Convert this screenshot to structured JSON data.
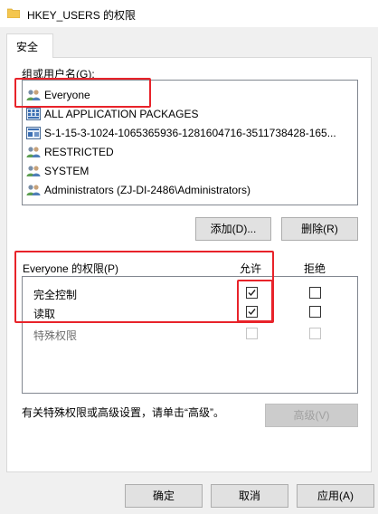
{
  "window": {
    "title": "HKEY_USERS 的权限",
    "icon": "folder-icon"
  },
  "tabs": [
    {
      "label": "安全",
      "active": true
    }
  ],
  "groups": {
    "label": "组或用户名(G):",
    "items": [
      {
        "name": "Everyone",
        "icon": "users-icon",
        "selected": false
      },
      {
        "name": "ALL APPLICATION PACKAGES",
        "icon": "packages-icon"
      },
      {
        "name": "S-1-15-3-1024-1065365936-1281604716-3511738428-165...",
        "icon": "sid-icon"
      },
      {
        "name": "RESTRICTED",
        "icon": "users-icon"
      },
      {
        "name": "SYSTEM",
        "icon": "users-icon"
      },
      {
        "name": "Administrators (ZJ-DI-2486\\Administrators)",
        "icon": "users-icon"
      }
    ]
  },
  "buttons": {
    "add": "添加(D)...",
    "remove": "删除(R)",
    "advanced": "高级(V)",
    "ok": "确定",
    "cancel": "取消",
    "apply": "应用(A)"
  },
  "permissions": {
    "label": "Everyone 的权限(P)",
    "allow_header": "允许",
    "deny_header": "拒绝",
    "rows": [
      {
        "name": "完全控制",
        "allow": true,
        "deny": false,
        "disabled": false
      },
      {
        "name": "读取",
        "allow": true,
        "deny": false,
        "disabled": false
      },
      {
        "name": "特殊权限",
        "allow": false,
        "deny": false,
        "disabled": true
      }
    ]
  },
  "advanced_note": "有关特殊权限或高级设置，请单击“高级”。",
  "colors": {
    "highlight": "#e8232a",
    "window_bg": "#f0f0f0",
    "panel_bg": "#ffffff"
  }
}
